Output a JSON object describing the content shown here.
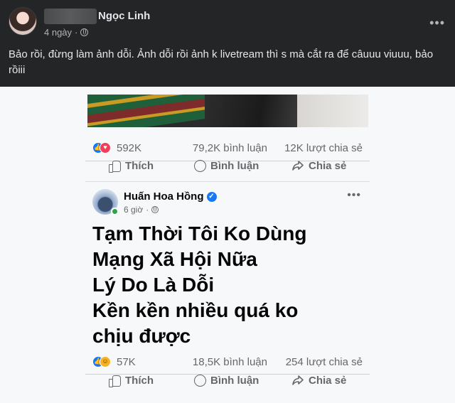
{
  "outer_post": {
    "author_name": "Ngọc Linh",
    "time": "4 ngày",
    "more_label": "•••",
    "caption": "Bảo rồi, đừng làm ảnh dỗi. Ảnh dỗi rồi ảnh k livetream thì s mà cắt ra để câuuu viuuu, bảo rồiii"
  },
  "first_post_stats": {
    "reactions": "592K",
    "comments": "79,2K bình luận",
    "shares": "12K lượt chia sẻ"
  },
  "actions": {
    "like": "Thích",
    "comment": "Bình luận",
    "share": "Chia sẻ"
  },
  "inner_post": {
    "author_name": "Huấn Hoa Hồng",
    "time": "6 giờ",
    "more_label": "•••",
    "lines": [
      "Tạm Thời Tôi Ko Dùng",
      "Mạng Xã Hội Nữa",
      "Lý Do Là Dỗi",
      "Kền kền nhiều quá ko",
      "chịu được"
    ],
    "reactions": "57K",
    "comments": "18,5K bình luận",
    "shares": "254 lượt chia sẻ"
  },
  "colors": {
    "dark_bg": "#242526",
    "like_blue": "#1877f2",
    "love_red": "#f33e58",
    "haha_yellow": "#f7b125",
    "online_green": "#31a24c"
  }
}
